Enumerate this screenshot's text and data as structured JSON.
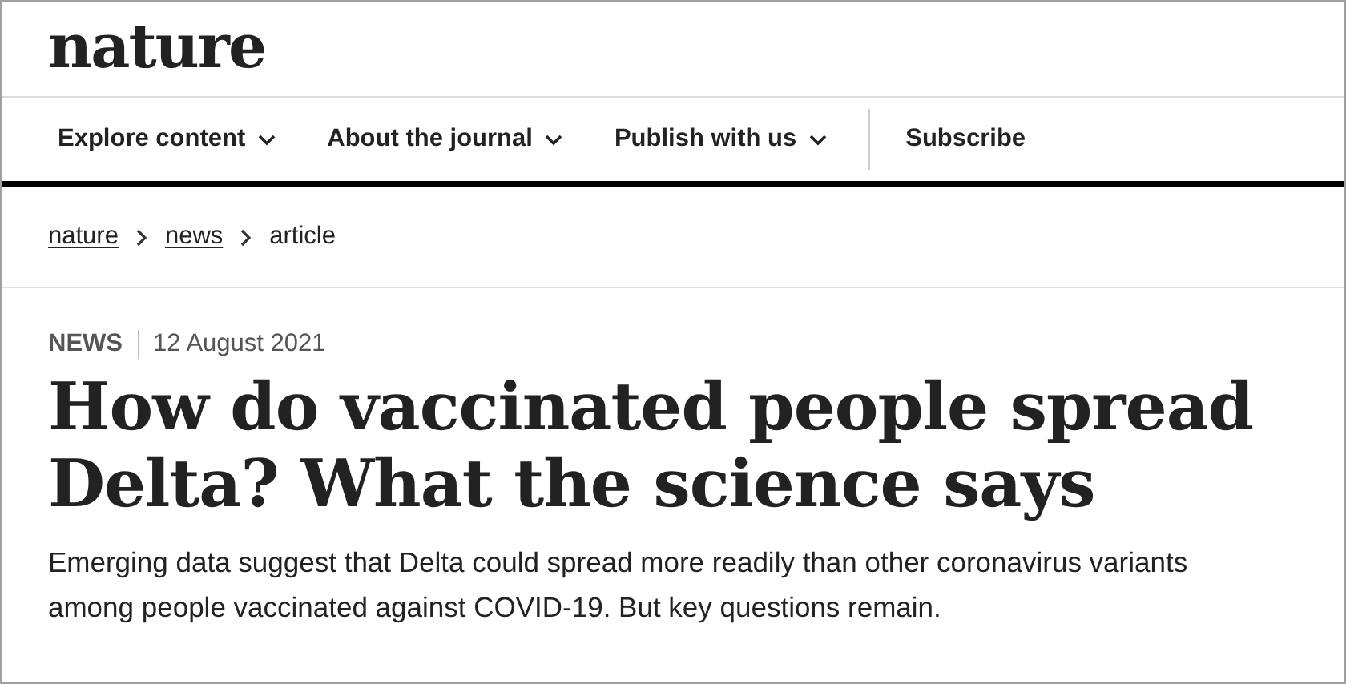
{
  "header": {
    "logo": "nature",
    "nav": [
      {
        "label": "Explore content",
        "dropdown": true
      },
      {
        "label": "About the journal",
        "dropdown": true
      },
      {
        "label": "Publish with us",
        "dropdown": true
      },
      {
        "label": "Subscribe",
        "dropdown": false
      }
    ]
  },
  "breadcrumb": [
    {
      "label": "nature",
      "link": true
    },
    {
      "label": "news",
      "link": true
    },
    {
      "label": "article",
      "link": false
    }
  ],
  "article": {
    "type": "NEWS",
    "date": "12 August 2021",
    "title": "How do vaccinated people spread Delta? What the science says",
    "summary": "Emerging data suggest that Delta could spread more readily than other coronavirus variants among people vaccinated against COVID-19. But key questions remain."
  }
}
